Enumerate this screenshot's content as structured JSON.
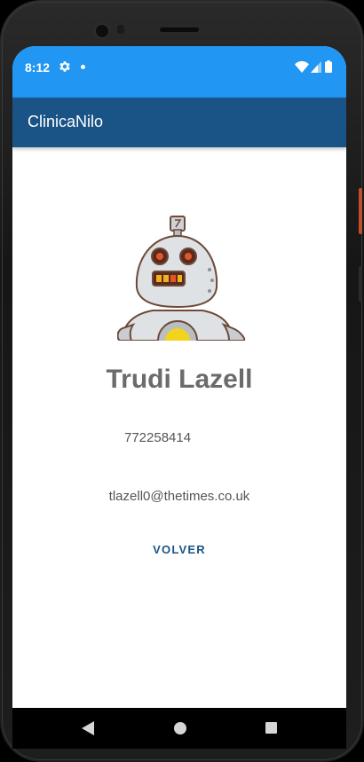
{
  "status_bar": {
    "time": "8:12",
    "color": "#2196f3"
  },
  "app_bar": {
    "title": "ClinicaNilo",
    "color": "#1a5486"
  },
  "profile": {
    "image_icon": "robot-avatar-icon",
    "name": "Trudi Lazell",
    "phone": "772258414",
    "email": "tlazell0@thetimes.co.uk"
  },
  "actions": {
    "back_label": "VOLVER"
  },
  "nav_bar": {
    "icons": [
      "back-icon",
      "home-icon",
      "recents-icon"
    ]
  }
}
